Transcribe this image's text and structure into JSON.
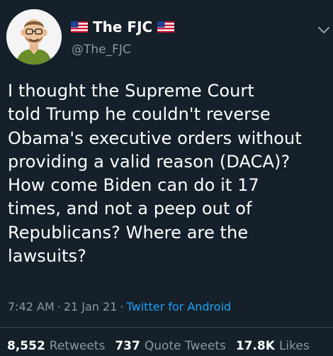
{
  "tweet": {
    "display_name": "The FJC",
    "handle": "@The_FJC",
    "text_lines": [
      "I thought the Supreme Court",
      "told Trump he couldn't reverse",
      "Obama's executive orders without",
      "providing a valid reason (DACA)?",
      "How come Biden can do it 17",
      "times, and not a peep out of",
      "Republicans? Where are the",
      "lawsuits?"
    ],
    "time": "7:42 AM",
    "date": "21 Jan 21",
    "separator": "·",
    "source": "Twitter for Android",
    "retweets_count": "8,552",
    "retweets_label": "Retweets",
    "quotes_count": "737",
    "quotes_label": "Quote Tweets",
    "likes_count": "17.8K",
    "likes_label": "Likes"
  },
  "icons": {
    "flag": "us-flag-icon",
    "avatar": "avatar",
    "menu": "chevron-down-icon"
  },
  "colors": {
    "background": "#15202b",
    "text": "#ffffff",
    "muted": "#8899a6",
    "link": "#1da1f2"
  }
}
